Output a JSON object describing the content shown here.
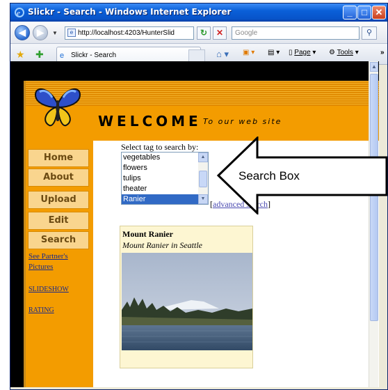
{
  "browser": {
    "title": "Slickr - Search - Windows Internet Explorer",
    "address": "http://localhost:4203/HunterSlid",
    "search_placeholder": "Google",
    "tab_label": "Slickr - Search",
    "tools": {
      "page": "Page",
      "tools": "Tools"
    }
  },
  "site": {
    "welcome": "WELCOME",
    "tagline": "To our web site",
    "nav": [
      {
        "label": "Home"
      },
      {
        "label": "About"
      },
      {
        "label": "Upload"
      },
      {
        "label": "Edit"
      },
      {
        "label": "Search"
      }
    ],
    "links": [
      {
        "label": "See Partner's"
      },
      {
        "label": "Pictures"
      },
      {
        "label": "SLIDESHOW"
      },
      {
        "label": "RATING"
      }
    ]
  },
  "search": {
    "label": "Select tag to search by:",
    "options": [
      "vegetables",
      "flowers",
      "tulips",
      "theater",
      "Ranier"
    ],
    "selected": "Ranier",
    "advanced_open": "[",
    "advanced_link": "advanced search",
    "advanced_close": "]"
  },
  "result": {
    "title": "Mount Ranier",
    "caption": "Mount Ranier in Seattle"
  },
  "annotation": {
    "callout_text": "Search Box"
  },
  "colors": {
    "banner": "#f39c00",
    "nav_button": "#f9d58e",
    "selection": "#316ac5"
  }
}
